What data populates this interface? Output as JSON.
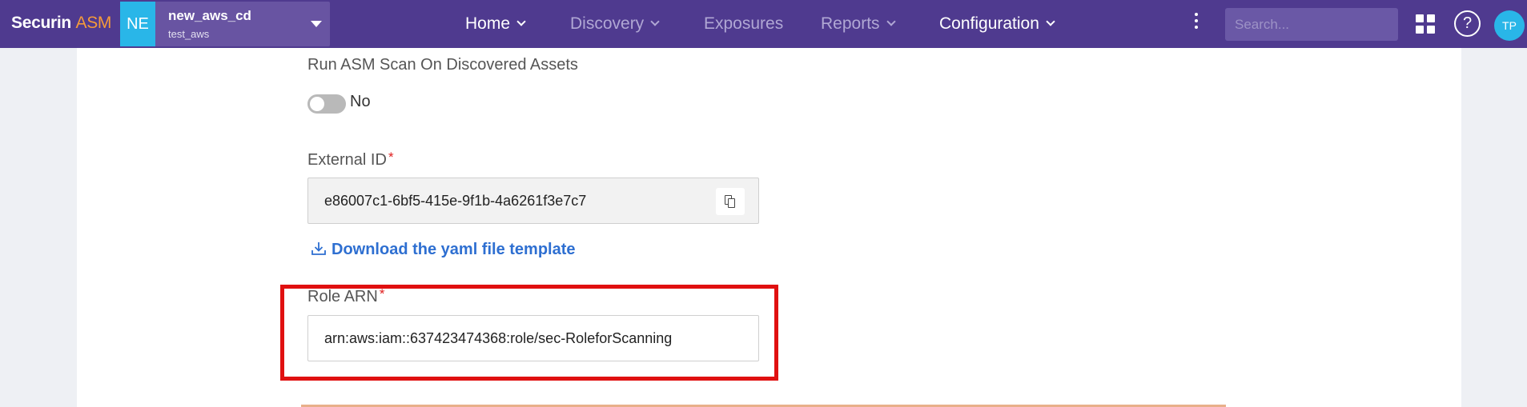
{
  "brand": {
    "name": "Securin",
    "product": "ASM"
  },
  "org": {
    "badge": "NE",
    "name": "new_aws_cd",
    "sub": "test_aws"
  },
  "nav": [
    {
      "label": "Home",
      "has_chevron": true,
      "state": "active"
    },
    {
      "label": "Discovery",
      "has_chevron": true,
      "state": "dim"
    },
    {
      "label": "Exposures",
      "has_chevron": false,
      "state": "dim"
    },
    {
      "label": "Reports",
      "has_chevron": true,
      "state": "dim"
    },
    {
      "label": "Configuration",
      "has_chevron": true,
      "state": "active"
    }
  ],
  "search": {
    "placeholder": "Search...",
    "value": ""
  },
  "user": {
    "initials": "TP"
  },
  "icons": {
    "apps": "apps-grid-icon",
    "help": "help-icon",
    "more": "kebab-icon",
    "copy": "copy-icon",
    "download": "download-icon"
  },
  "help_glyph": "?",
  "form": {
    "scan_label": "Run ASM Scan On Discovered Assets",
    "scan_toggle_state": "No",
    "external_id_label": "External ID",
    "external_id_value": "e86007c1-6bf5-415e-9f1b-4a6261f3e7c7",
    "download_link": "Download the yaml file template",
    "role_arn_label": "Role ARN",
    "role_arn_value": "arn:aws:iam::637423474368:role/sec-RoleforScanning",
    "required_marker": "*"
  },
  "colors": {
    "topbar": "#4f3a8f",
    "accent_orange": "#f59a3a",
    "badge_blue": "#29b6e8",
    "link_blue": "#2e6fd1",
    "highlight_red": "#e01010"
  }
}
